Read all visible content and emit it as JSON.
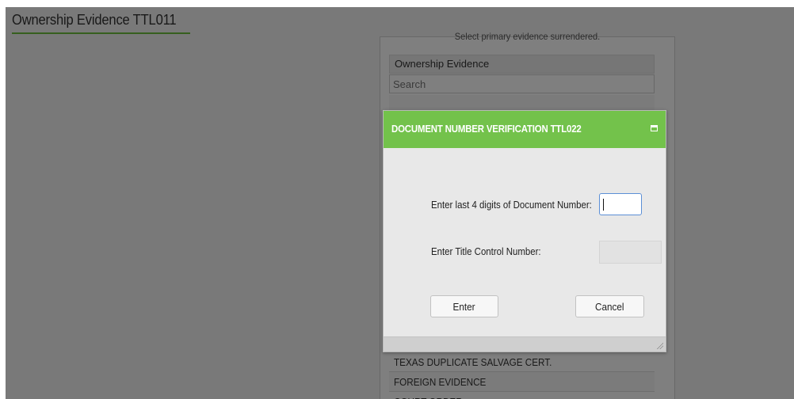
{
  "page": {
    "title": "Ownership Evidence TTL011"
  },
  "panel": {
    "prompt": "Select primary evidence surrendered.",
    "header": "Ownership Evidence",
    "search_placeholder": "Search",
    "items": [
      {
        "label": ""
      },
      {
        "label": ""
      },
      {
        "label": ""
      },
      {
        "label": ""
      },
      {
        "label": ""
      },
      {
        "label": ""
      },
      {
        "label": ""
      },
      {
        "label": ""
      },
      {
        "label": ""
      },
      {
        "label": ""
      },
      {
        "label": ""
      },
      {
        "label": ""
      },
      {
        "label": ""
      },
      {
        "label": "TEXAS DUPLICATE SALVAGE CERT."
      },
      {
        "label": "FOREIGN EVIDENCE"
      },
      {
        "label": "COURT ORDER"
      }
    ]
  },
  "dialog": {
    "title": "DOCUMENT NUMBER VERIFICATION TTL022",
    "doc_label": "Enter last 4 digits of Document Number:",
    "doc_value": "",
    "tcn_label": "Enter Title Control Number:",
    "tcn_value": "",
    "enter_label": "Enter",
    "cancel_label": "Cancel"
  },
  "colors": {
    "accent": "#73c24b",
    "underline": "#6cbf3c",
    "overlay": "rgba(0,0,0,0.5)"
  },
  "icons": {
    "maximize": "maximize-icon",
    "resize": "resize-grip-icon"
  }
}
